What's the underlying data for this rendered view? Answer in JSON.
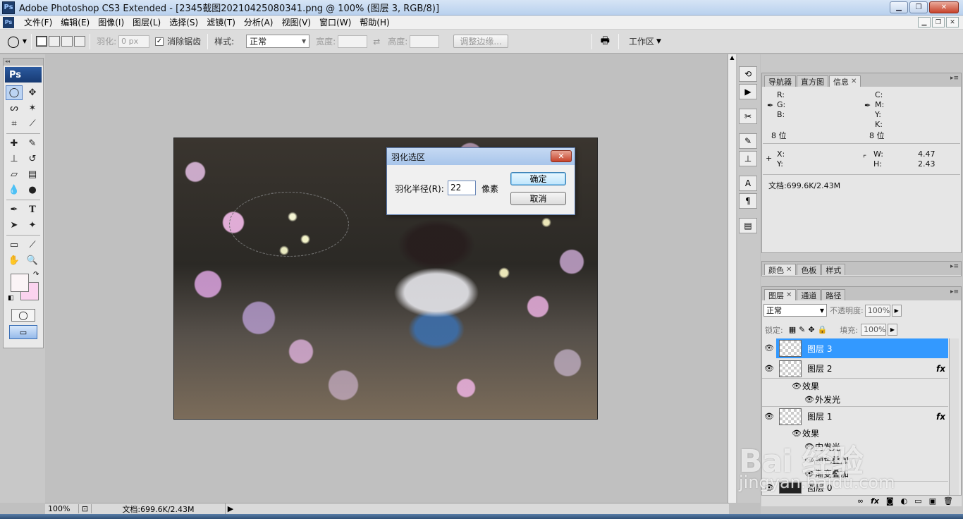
{
  "window": {
    "title": "Adobe Photoshop CS3 Extended - [2345截图20210425080341.png @ 100% (图层 3, RGB/8)]",
    "app_icon": "Ps"
  },
  "menu": [
    "文件(F)",
    "编辑(E)",
    "图像(I)",
    "图层(L)",
    "选择(S)",
    "滤镜(T)",
    "分析(A)",
    "视图(V)",
    "窗口(W)",
    "帮助(H)"
  ],
  "options": {
    "feather_label": "羽化:",
    "feather_value": "0 px",
    "antialias_label": "消除锯齿",
    "antialias_checked": true,
    "style_label": "样式:",
    "style_value": "正常",
    "width_label": "宽度:",
    "height_label": "高度:",
    "refine_edge": "调整边缘...",
    "workspace": "工作区"
  },
  "toolbox": {
    "logo": "Ps",
    "foreground_color": "#fbf4f6",
    "background_color": "#fbd3ef"
  },
  "dialog": {
    "title": "羽化选区",
    "radius_label": "羽化半径(R):",
    "radius_value": "22",
    "unit": "像素",
    "ok": "确定",
    "cancel": "取消"
  },
  "statusbar": {
    "zoom": "100%",
    "doc_info": "文档:699.6K/2.43M"
  },
  "panels": {
    "info_tabs": [
      "导航器",
      "直方图",
      "信息"
    ],
    "info": {
      "r": "R:",
      "g": "G:",
      "b": "B:",
      "c": "C:",
      "m": "M:",
      "y": "Y:",
      "k": "K:",
      "bits_left": "8 位",
      "bits_right": "8 位",
      "x": "X:",
      "y2": "Y:",
      "w": "W:",
      "w_val": "4.47",
      "h": "H:",
      "h_val": "2.43",
      "doc": "文档:699.6K/2.43M"
    },
    "color_tabs": [
      "颜色",
      "色板",
      "样式"
    ],
    "layer_tabs": [
      "图层",
      "通道",
      "路径"
    ],
    "blend_mode": "正常",
    "opacity_label": "不透明度:",
    "opacity_value": "100%",
    "lock_label": "锁定:",
    "fill_label": "填充:",
    "fill_value": "100%",
    "layers": [
      {
        "name": "图层 3",
        "selected": true,
        "fx": ""
      },
      {
        "name": "图层 2",
        "selected": false,
        "fx": "fx"
      },
      {
        "name": "图层 1",
        "selected": false,
        "fx": "fx"
      },
      {
        "name": "图层 0",
        "selected": false,
        "fx": ""
      }
    ],
    "effects_label": "效果",
    "layer2_effects": [
      "外发光"
    ],
    "layer1_effects": [
      "内发光",
      "颜色叠加",
      "渐变叠加"
    ]
  },
  "watermark": {
    "brand": "Bai 经验",
    "url": "jingyan.baidu.com"
  }
}
